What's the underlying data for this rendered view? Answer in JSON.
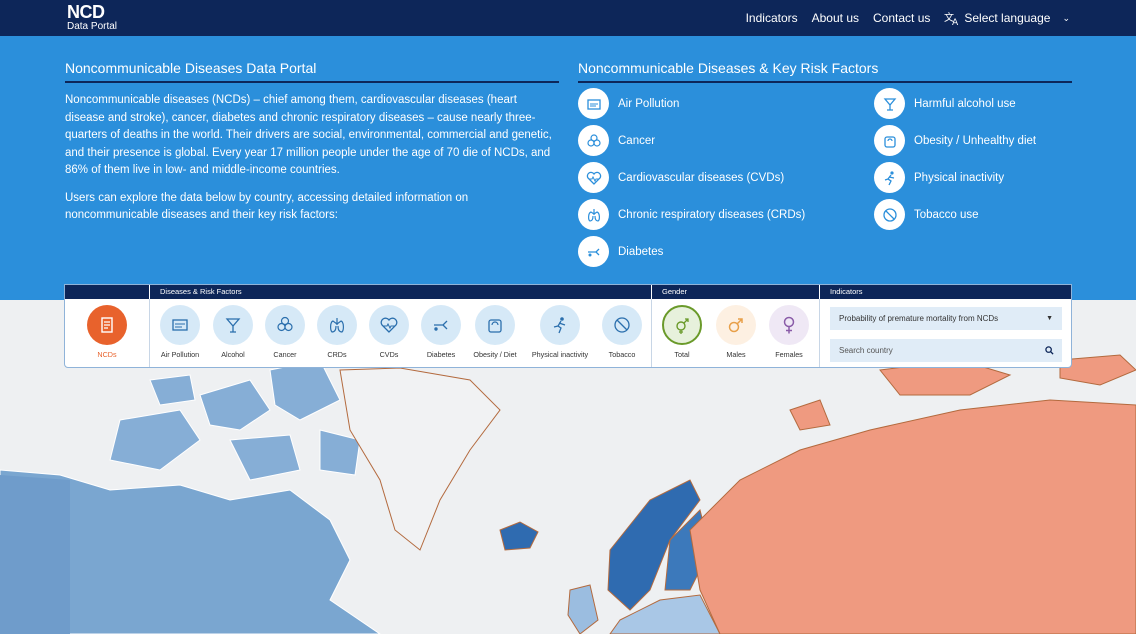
{
  "nav": {
    "logo_main": "NCD",
    "logo_sub": "Data Portal",
    "links": [
      "Indicators",
      "About us",
      "Contact us"
    ],
    "language": "Select language"
  },
  "intro": {
    "title": "Noncommunicable Diseases Data Portal",
    "para1": "Noncommunicable diseases (NCDs) – chief among them, cardiovascular diseases (heart disease and stroke), cancer, diabetes and chronic respiratory diseases – cause nearly three-quarters of deaths in the world. Their drivers are social, environmental, commercial and genetic, and their presence is global. Every year 17 million people under the age of 70 die of NCDs, and 86% of them live in low- and middle-income countries.",
    "para2": "Users can explore the data below by country, accessing detailed information on noncommunicable diseases and their key risk factors:"
  },
  "risks": {
    "title": "Noncommunicable Diseases & Key Risk Factors",
    "left": [
      "Air Pollution",
      "Cancer",
      "Cardiovascular diseases (CVDs)",
      "Chronic respiratory diseases (CRDs)",
      "Diabetes"
    ],
    "right": [
      "Harmful alcohol use",
      "Obesity / Unhealthy diet",
      "Physical inactivity",
      "Tobacco use"
    ]
  },
  "panel": {
    "headers": {
      "diseases": "Diseases & Risk Factors",
      "gender": "Gender",
      "indicators": "Indicators"
    },
    "ncd_label": "NCDs",
    "factors": [
      "Air Pollution",
      "Alcohol",
      "Cancer",
      "CRDs",
      "CVDs",
      "Diabetes",
      "Obesity / Diet",
      "Physical inactivity",
      "Tobacco"
    ],
    "genders": [
      "Total",
      "Males",
      "Females"
    ],
    "indicator_selected": "Probability of premature mortality from NCDs",
    "search_placeholder": "Search country"
  },
  "colors": {
    "navy": "#0d2659",
    "hero_blue": "#2b8fdb",
    "accent_orange": "#e8622c",
    "gender_green": "#6a9a2a",
    "map_russia": "#ef9a80",
    "map_europe_dark": "#2f6bb0",
    "map_land_blue": "#7aa6d0"
  }
}
